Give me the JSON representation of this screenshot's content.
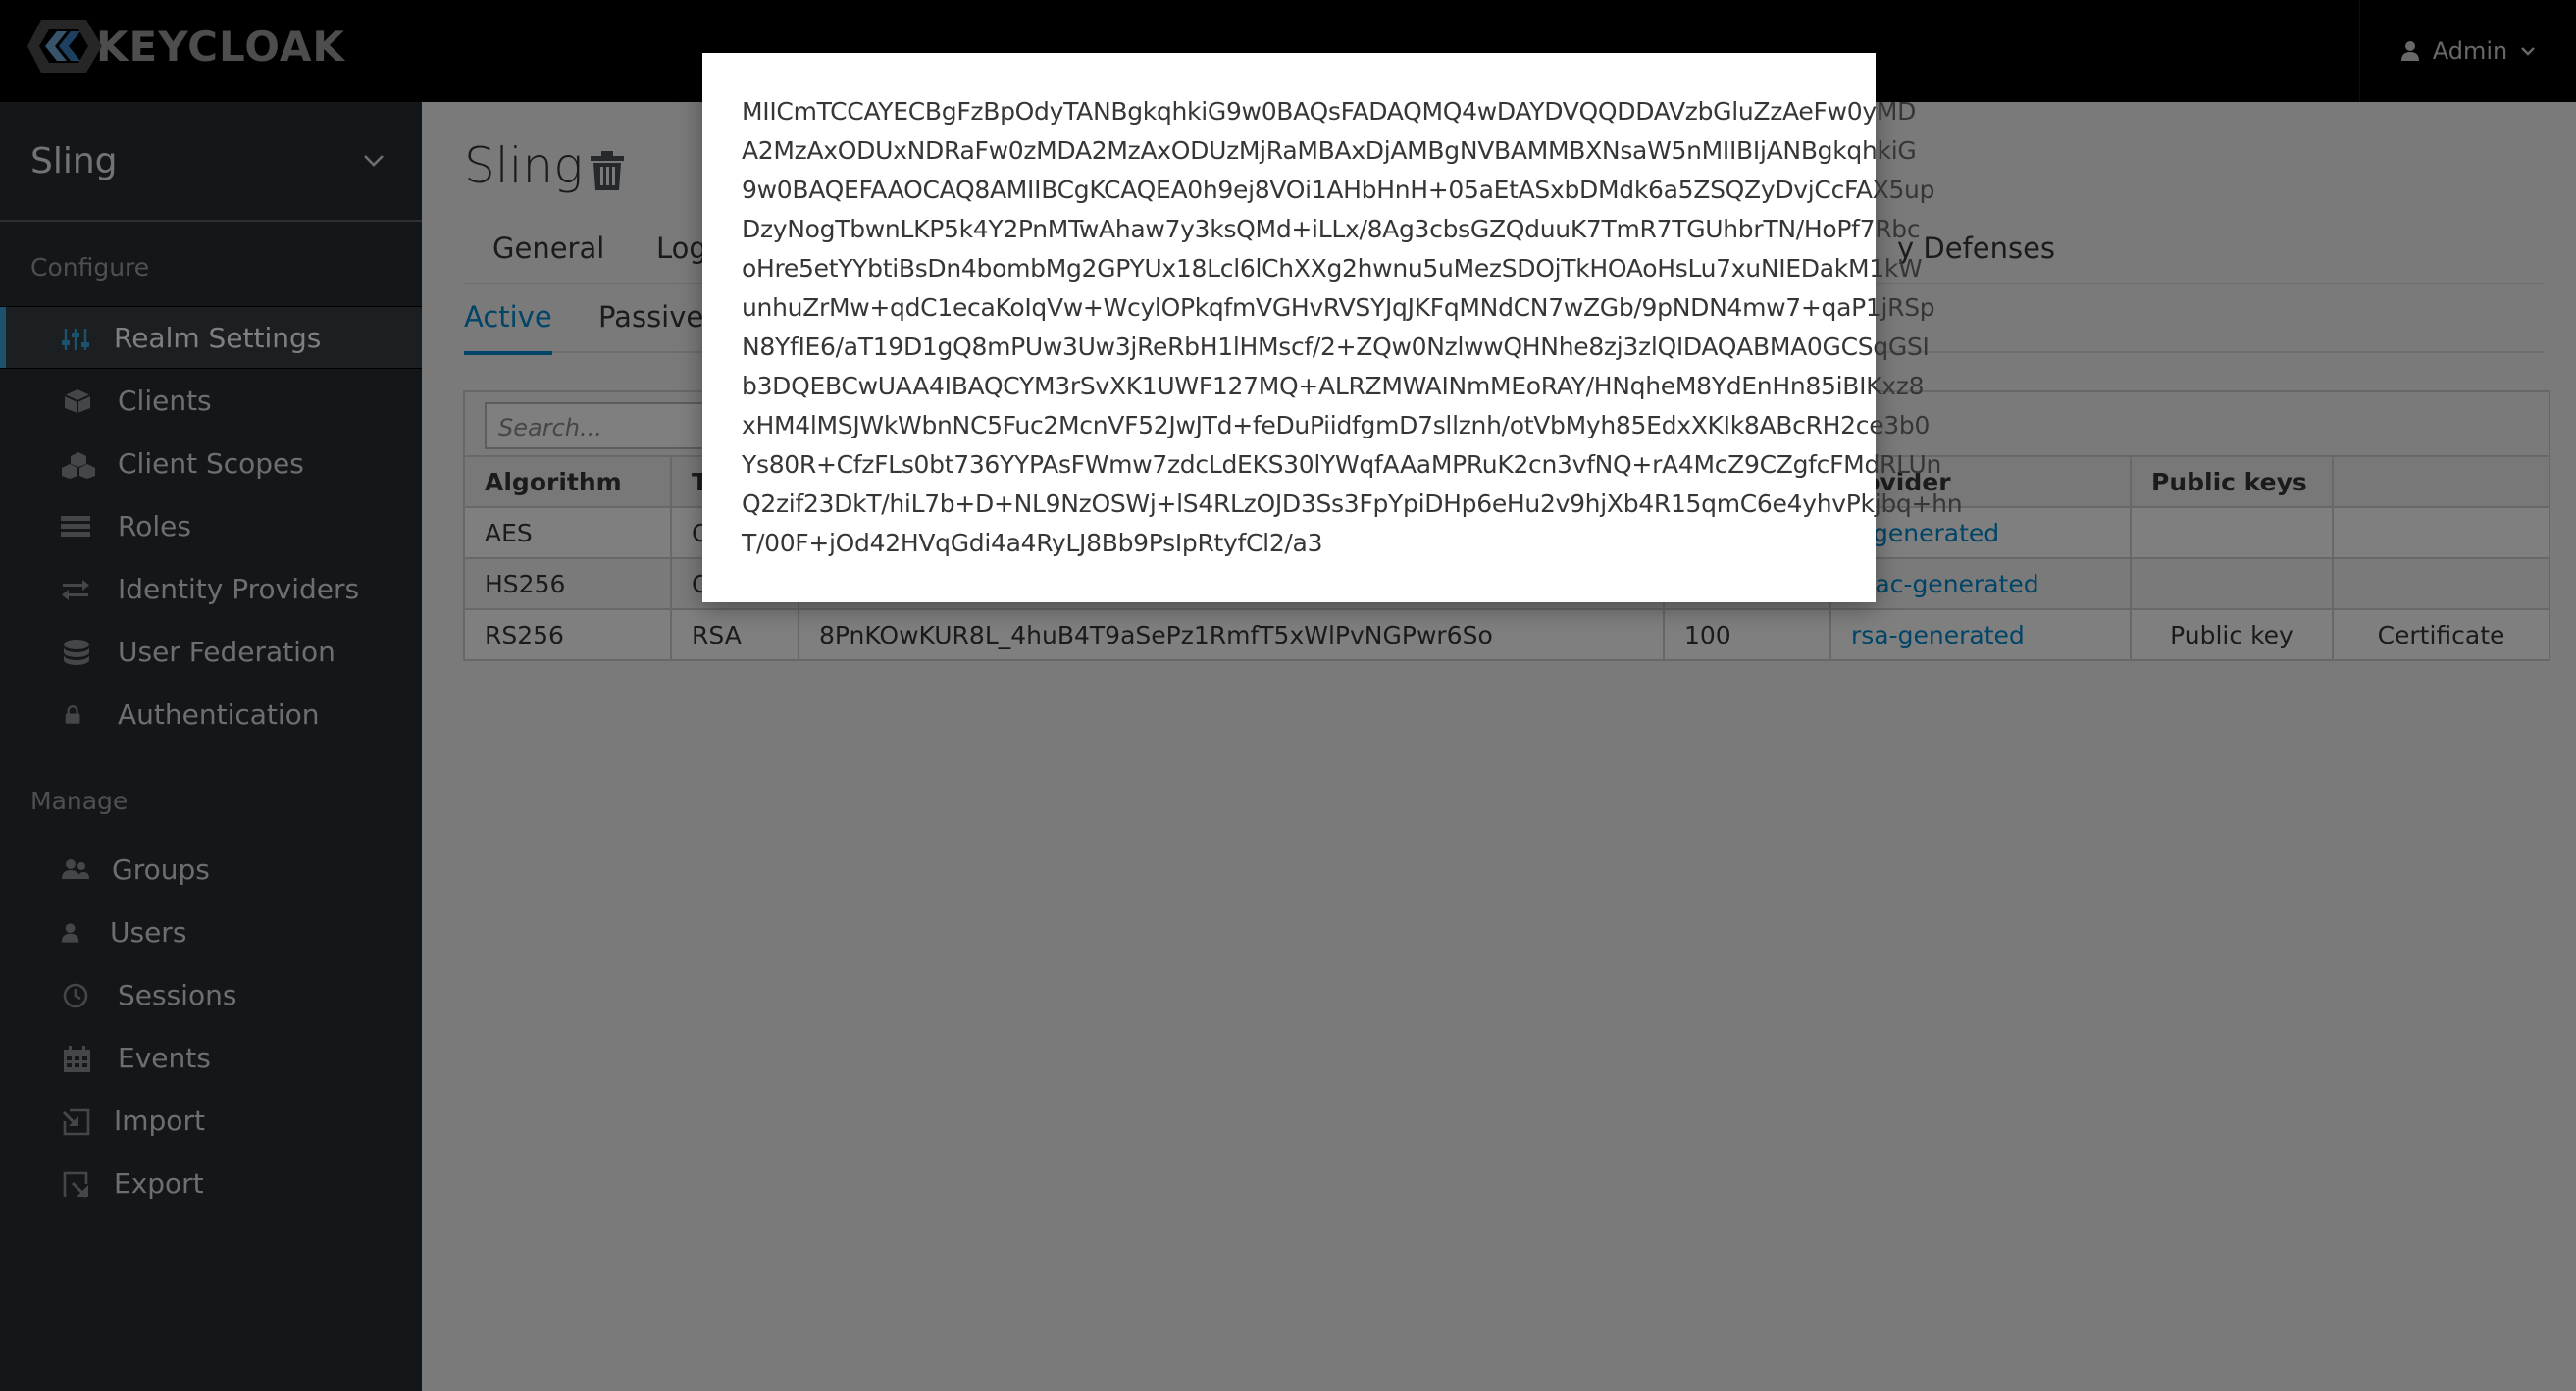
{
  "app": {
    "logo_text": "KEYCLOAK",
    "user_label": "Admin"
  },
  "sidebar": {
    "realm": "Sling",
    "configure_label": "Configure",
    "manage_label": "Manage",
    "configure_items": [
      {
        "label": "Realm Settings",
        "icon": "sliders-icon"
      },
      {
        "label": "Clients",
        "icon": "cube-icon"
      },
      {
        "label": "Client Scopes",
        "icon": "cubes-icon"
      },
      {
        "label": "Roles",
        "icon": "list-icon"
      },
      {
        "label": "Identity Providers",
        "icon": "exchange-icon"
      },
      {
        "label": "User Federation",
        "icon": "database-icon"
      },
      {
        "label": "Authentication",
        "icon": "lock-icon"
      }
    ],
    "manage_items": [
      {
        "label": "Groups",
        "icon": "users-icon"
      },
      {
        "label": "Users",
        "icon": "user-icon"
      },
      {
        "label": "Sessions",
        "icon": "clock-icon"
      },
      {
        "label": "Events",
        "icon": "calendar-icon"
      },
      {
        "label": "Import",
        "icon": "import-icon"
      },
      {
        "label": "Export",
        "icon": "export-icon"
      }
    ]
  },
  "main": {
    "title": "Sling",
    "tabs": [
      "General",
      "Log",
      "y Defenses"
    ],
    "subtabs": [
      "Active",
      "Passive"
    ],
    "search_placeholder": "Search...",
    "columns": [
      "Algorithm",
      "T",
      "",
      "",
      "rovider",
      "Public keys",
      ""
    ],
    "rows": [
      {
        "algorithm": "AES",
        "type": "O",
        "kid": "",
        "priority": "",
        "provider": "s-generated",
        "public_key": "",
        "certificate": ""
      },
      {
        "algorithm": "HS256",
        "type": "O",
        "kid": "",
        "priority": "",
        "provider": "mac-generated",
        "public_key": "",
        "certificate": ""
      },
      {
        "algorithm": "RS256",
        "type": "RSA",
        "kid": "8PnKOwKUR8L_4huB4T9aSePz1RmfT5xWlPvNGPwr6So",
        "priority": "100",
        "provider": "rsa-generated",
        "public_key": "Public key",
        "certificate": "Certificate"
      }
    ]
  },
  "modal": {
    "lines": [
      "MIICmTCCAYECBgFzBpOdyTANBgkqhkiG9w0BAQsFADAQMQ4wDAYDVQQDDAVzbGluZzAeFw0yMD",
      "A2MzAxODUxNDRaFw0zMDA2MzAxODUzMjRaMBAxDjAMBgNVBAMMBXNsaW5nMIIBIjANBgkqhkiG",
      "9w0BAQEFAAOCAQ8AMIIBCgKCAQEA0h9ej8VOi1AHbHnH+05aEtASxbDMdk6a5ZSQZyDvjCcFAX5up",
      "DzyNogTbwnLKP5k4Y2PnMTwAhaw7y3ksQMd+iLLx/8Ag3cbsGZQduuK7TmR7TGUhbrTN/HoPf7Rbc",
      "oHre5etYYbtiBsDn4bombMg2GPYUx18Lcl6lChXXg2hwnu5uMezSDOjTkHOAoHsLu7xuNIEDakM1kW",
      "unhuZrMw+qdC1ecaKoIqVw+WcylOPkqfmVGHvRVSYJqJKFqMNdCN7wZGb/9pNDN4mw7+qaP1jRSp",
      "N8YfIE6/aT19D1gQ8mPUw3Uw3jReRbH1lHMscf/2+ZQw0NzlwwQHNhe8zj3zlQIDAQABMA0GCSqGSI",
      "b3DQEBCwUAA4IBAQCYM3rSvXK1UWF127MQ+ALRZMWAINmMEoRAY/HNqheM8YdEnHn85iBIKxz8",
      "xHM4lMSJWkWbnNC5Fuc2McnVF52JwJTd+feDuPiidfgmD7sllznh/otVbMyh85EdxXKIk8ABcRH2ce3b0",
      "Ys80R+CfzFLs0bt736YYPAsFWmw7zdcLdEKS30lYWqfAAaMPRuK2cn3vfNQ+rA4McZ9CZgfcFMdRLUn",
      "Q2zif23DkT/hiL7b+D+NL9NzOSWj+lS4RLzOJD3Ss3FpYpiDHp6eHu2v9hjXb4R15qmC6e4yhvPkjbq+hn",
      "T/00F+jOd42HVqGdi4a4RyLJ8Bb9PsIpRtyfCl2/a3"
    ]
  },
  "colors": {
    "sidebar_bg": "#292e34",
    "header_bg": "#000000",
    "accent": "#0088ce",
    "active_indicator": "#39a5dc"
  }
}
